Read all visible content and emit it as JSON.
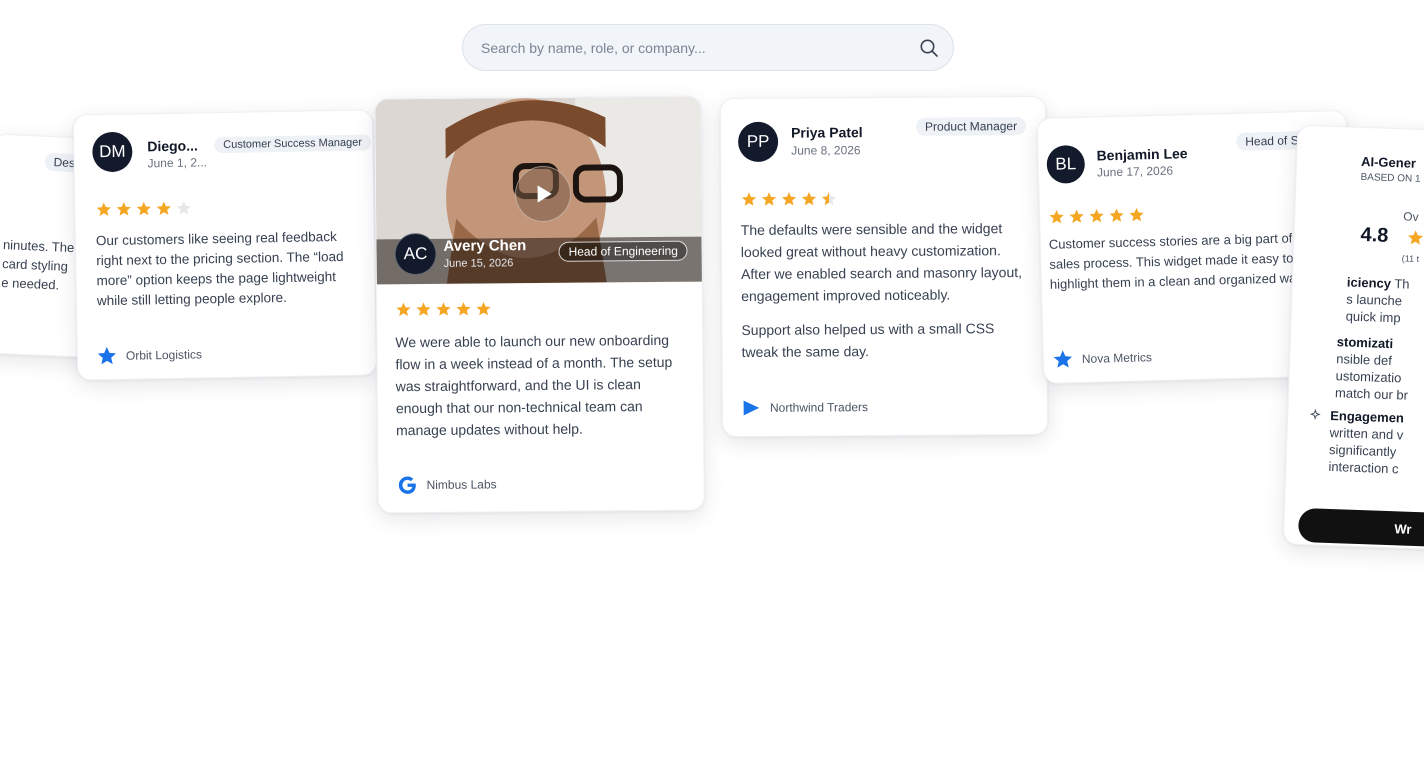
{
  "search": {
    "placeholder": "Search by name, role, or company..."
  },
  "colors": {
    "star": "#f5a623",
    "star_empty": "#e5e7eb",
    "avatar_bg": "#121a2c",
    "company_icon": "#1a73e8"
  },
  "left_card": {
    "badge": "Desig",
    "lines": [
      "ninutes. The",
      "card styling",
      "e needed."
    ]
  },
  "cards": [
    {
      "initials": "DM",
      "name": "Diego...",
      "date": "June 1, 2...",
      "role": "Customer Success Manager",
      "rating": 4,
      "text": "Our customers like seeing real feedback right next to the pricing section. The “load more” option keeps the page lightweight while still letting people explore.",
      "company": "Orbit Logistics",
      "company_icon": "star-icon"
    },
    {
      "initials": "AC",
      "name": "Avery Chen",
      "date": "June 15, 2026",
      "role": "Head of Engineering",
      "rating": 5,
      "text": "We were able to launch our new onboarding flow in a week instead of a month. The setup was straightforward, and the UI is clean enough that our non-technical team can manage updates without help.",
      "company": "Nimbus Labs",
      "company_icon": "google-g-icon"
    },
    {
      "initials": "PP",
      "name": "Priya Patel",
      "date": "June 8, 2026",
      "role": "Product Manager",
      "rating": 4.5,
      "text": "The defaults were sensible and the widget looked great without heavy customization. After we enabled search and masonry layout, engagement improved noticeably.",
      "text2": "Support also helped us with a small CSS tweak the same day.",
      "company": "Northwind Traders",
      "company_icon": "play-triangle-icon"
    },
    {
      "initials": "BL",
      "name": "Benjamin Lee",
      "date": "June 17, 2026",
      "role": "Head of Sales",
      "rating": 5,
      "text": "Customer success stories are a big part of our sales process. This widget made it easy to highlight them in a clean and organized way.",
      "company": "Nova Metrics",
      "company_icon": "star-icon"
    }
  ],
  "ai_summary": {
    "title": "AI-Gener",
    "subtitle": "BASED ON 1",
    "overall_label": "Ov",
    "score": "4.8",
    "count": "(11 t",
    "items": [
      {
        "head": "iciency",
        "rest": " Th",
        "lines": [
          "s launche",
          "quick imp"
        ]
      },
      {
        "head": "stomizati",
        "rest": "",
        "lines": [
          "nsible def",
          "ustomizatio",
          "match our br"
        ]
      },
      {
        "head": "Engagemen",
        "rest": "",
        "lines": [
          "written and v",
          "significantly",
          "interaction c"
        ]
      }
    ],
    "button": "Wr"
  }
}
